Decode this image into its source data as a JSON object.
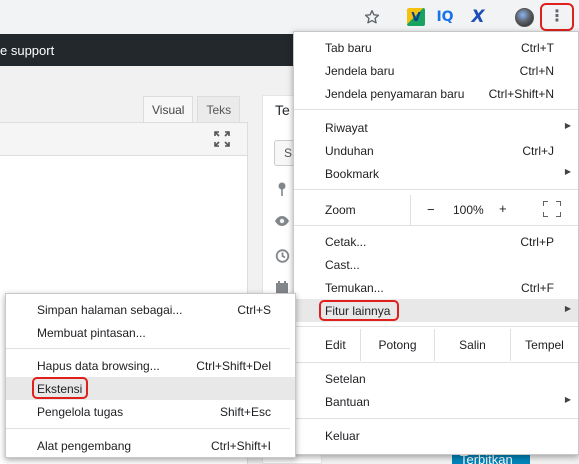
{
  "toolbar": {
    "star_icon": "star-outline-icon",
    "extensions": [
      {
        "name": "extension-v-icon",
        "label": "V"
      },
      {
        "name": "extension-iq-icon",
        "label": "IQ"
      },
      {
        "name": "extension-x-icon",
        "label": "X"
      }
    ],
    "profile_icon": "profile-avatar",
    "menu_icon": "vertical-dots-icon",
    "menu_glyph": "⋮"
  },
  "admin_bar": {
    "support_text": "e support"
  },
  "editor": {
    "tab_visual": "Visual",
    "tab_text": "Teks",
    "fullscreen_icon": "expand-icon"
  },
  "publish_panel": {
    "title_fragment": "Te",
    "small_button_fragment": "S",
    "publish_button": "Terbitkan"
  },
  "chrome_menu": {
    "new_tab": "Tab baru",
    "new_tab_shortcut": "Ctrl+T",
    "new_window": "Jendela baru",
    "new_window_shortcut": "Ctrl+N",
    "incognito": "Jendela penyamaran baru",
    "incognito_shortcut": "Ctrl+Shift+N",
    "history": "Riwayat",
    "downloads": "Unduhan",
    "downloads_shortcut": "Ctrl+J",
    "bookmarks": "Bookmark",
    "zoom_label": "Zoom",
    "zoom_minus": "−",
    "zoom_value": "100%",
    "zoom_plus": "+",
    "print": "Cetak...",
    "print_shortcut": "Ctrl+P",
    "cast": "Cast...",
    "find": "Temukan...",
    "find_shortcut": "Ctrl+F",
    "more_tools": "Fitur lainnya",
    "edit_label": "Edit",
    "cut": "Potong",
    "copy": "Salin",
    "paste": "Tempel",
    "settings": "Setelan",
    "help": "Bantuan",
    "exit": "Keluar"
  },
  "more_tools_menu": {
    "save_page": "Simpan halaman sebagai...",
    "save_page_shortcut": "Ctrl+S",
    "create_shortcut": "Membuat pintasan...",
    "clear_data": "Hapus data browsing...",
    "clear_data_shortcut": "Ctrl+Shift+Del",
    "extensions": "Ekstensi",
    "task_manager": "Pengelola tugas",
    "task_manager_shortcut": "Shift+Esc",
    "dev_tools": "Alat pengembang",
    "dev_tools_shortcut": "Ctrl+Shift+I"
  },
  "colors": {
    "highlight_outline": "#e0201c",
    "admin_bar": "#23282d",
    "publish_button": "#0085ba"
  }
}
